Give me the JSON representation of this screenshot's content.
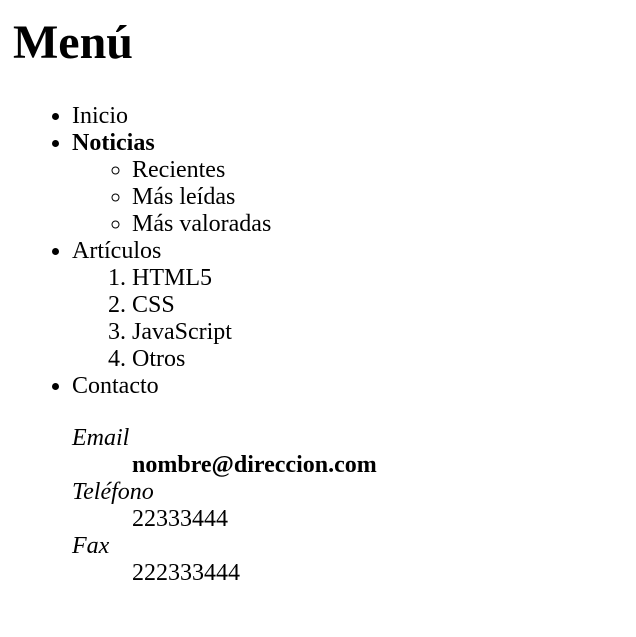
{
  "title": "Menú",
  "menu": {
    "items": [
      {
        "label": "Inicio"
      },
      {
        "label": "Noticias",
        "subitems": [
          "Recientes",
          "Más leídas",
          "Más valoradas"
        ]
      },
      {
        "label": "Artículos",
        "subitems": [
          "HTML5",
          "CSS",
          "JavaScript",
          "Otros"
        ]
      },
      {
        "label": "Contacto"
      }
    ]
  },
  "contact": {
    "email_label": "Email",
    "email_value": "nombre@direccion.com",
    "phone_label": "Teléfono",
    "phone_value": "22333444",
    "fax_label": "Fax",
    "fax_value": "222333444"
  }
}
